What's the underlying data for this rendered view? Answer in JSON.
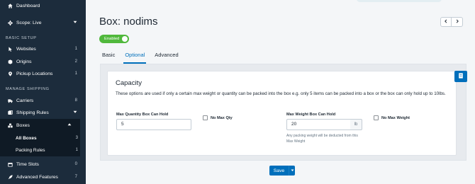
{
  "sidebar": {
    "dashboard": "Dashboard",
    "scope": "Scope: Live",
    "basic_setup_heading": "BASIC SETUP",
    "manage_shipping_heading": "MANAGE SHIPPING",
    "items": {
      "websites": {
        "label": "Websites",
        "count": "1"
      },
      "origins": {
        "label": "Origins",
        "count": "2"
      },
      "pickup_locations": {
        "label": "Pickup Locations",
        "count": "1"
      },
      "carriers": {
        "label": "Carriers",
        "count": "8"
      },
      "shipping_rules": {
        "label": "Shipping Rules"
      },
      "boxes": {
        "label": "Boxes"
      },
      "all_boxes": {
        "label": "All Boxes",
        "count": "3"
      },
      "packing_rules": {
        "label": "Packing Rules",
        "count": "1"
      },
      "time_slots": {
        "label": "Time Slots",
        "count": "0"
      },
      "advanced_features": {
        "label": "Advanced Features",
        "count": "7"
      }
    }
  },
  "page": {
    "title": "Box: nodims",
    "status_toggle": "Enabled",
    "tabs": [
      "Basic",
      "Optional",
      "Advanced"
    ],
    "active_tab": "Optional"
  },
  "capacity": {
    "title": "Capacity",
    "description": "These options are used if only a certain max weight or quantity can be packed into the box e.g. only 5 items can be packed into a box or the box can only hold up to 10lbs.",
    "max_qty_label": "Max Quantity Box Can Hold",
    "max_qty_value": "5",
    "no_max_qty_label": "No Max Qty",
    "max_weight_label": "Max Weight Box Can Hold",
    "max_weight_value": "20",
    "max_weight_unit": "lb",
    "max_weight_help": "Any packing weight will be deducted from this Max Weight",
    "no_max_weight_label": "No Max Weight"
  },
  "actions": {
    "save": "Save"
  },
  "colors": {
    "sidebar_bg": "#1c2c3c",
    "accent": "#006fbb",
    "enabled": "#50b83c"
  }
}
